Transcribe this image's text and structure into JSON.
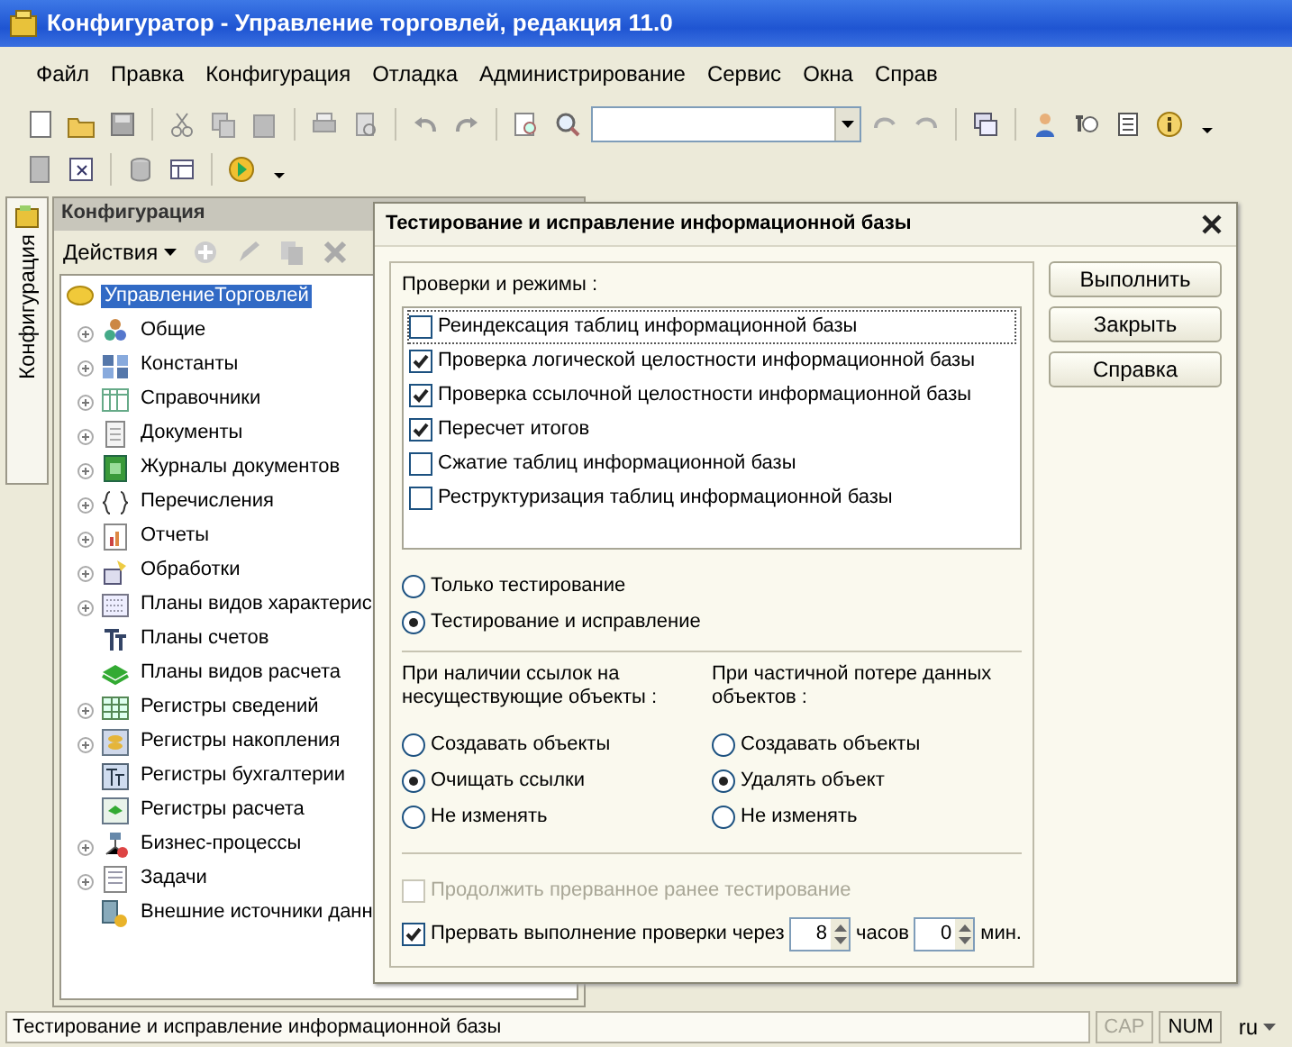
{
  "window": {
    "title": "Конфигуратор - Управление торговлей, редакция 11.0"
  },
  "menu": [
    "Файл",
    "Правка",
    "Конфигурация",
    "Отладка",
    "Администрирование",
    "Сервис",
    "Окна",
    "Справ"
  ],
  "side_tab": {
    "label": "Конфигурация",
    "selected": true
  },
  "config_panel": {
    "title": "Конфигурация",
    "actions": "Действия",
    "tree": {
      "label": "УправлениеТорговлей",
      "selected": true,
      "children": [
        {
          "label": "Общие",
          "expandable": true
        },
        {
          "label": "Константы",
          "expandable": true
        },
        {
          "label": "Справочники",
          "expandable": true
        },
        {
          "label": "Документы",
          "expandable": true
        },
        {
          "label": "Журналы документов",
          "expandable": true
        },
        {
          "label": "Перечисления",
          "expandable": true
        },
        {
          "label": "Отчеты",
          "expandable": true
        },
        {
          "label": "Обработки",
          "expandable": true
        },
        {
          "label": "Планы видов характерис",
          "expandable": true
        },
        {
          "label": "Планы счетов",
          "expandable": false
        },
        {
          "label": "Планы видов расчета",
          "expandable": false
        },
        {
          "label": "Регистры сведений",
          "expandable": true
        },
        {
          "label": "Регистры накопления",
          "expandable": true
        },
        {
          "label": "Регистры бухгалтерии",
          "expandable": false
        },
        {
          "label": "Регистры расчета",
          "expandable": false
        },
        {
          "label": "Бизнес-процессы",
          "expandable": true
        },
        {
          "label": "Задачи",
          "expandable": true
        },
        {
          "label": "Внешние источники данн",
          "expandable": false
        }
      ]
    }
  },
  "dialog": {
    "title": "Тестирование и исправление информационной базы",
    "checks_label": "Проверки и режимы :",
    "checks": [
      {
        "label": "Реиндексация таблиц информационной базы",
        "checked": false,
        "focused": true
      },
      {
        "label": "Проверка логической целостности информационной базы",
        "checked": true,
        "focused": false
      },
      {
        "label": "Проверка ссылочной целостности информационной базы",
        "checked": true,
        "focused": false
      },
      {
        "label": "Пересчет итогов",
        "checked": true,
        "focused": false
      },
      {
        "label": "Сжатие таблиц информационной базы",
        "checked": false,
        "focused": false
      },
      {
        "label": "Реструктуризация таблиц информационной базы",
        "checked": false,
        "focused": false
      }
    ],
    "modes": [
      {
        "label": "Только тестирование",
        "selected": false
      },
      {
        "label": "Тестирование и исправление",
        "selected": true
      }
    ],
    "groups": [
      {
        "label": "При наличии ссылок на несуществующие объекты :",
        "options": [
          {
            "label": "Создавать объекты",
            "selected": false
          },
          {
            "label": "Очищать ссылки",
            "selected": true
          },
          {
            "label": "Не изменять",
            "selected": false
          }
        ]
      },
      {
        "label": "При частичной потере данных объектов :",
        "options": [
          {
            "label": "Создавать объекты",
            "selected": false
          },
          {
            "label": "Удалять объект",
            "selected": true
          },
          {
            "label": "Не изменять",
            "selected": false
          }
        ]
      }
    ],
    "resume": {
      "label": "Продолжить прерванное ранее тестирование",
      "checked": false,
      "disabled": true
    },
    "interrupt": {
      "label": "Прервать выполнение проверки через",
      "checked": true,
      "hours": "8",
      "hours_unit": "часов",
      "minutes": "0",
      "minutes_unit": "мин."
    },
    "buttons": [
      "Выполнить",
      "Закрыть",
      "Справка"
    ]
  },
  "status_bar": {
    "text": "Тестирование и исправление информационной базы",
    "indicators": [
      {
        "label": "CAP",
        "on": false
      },
      {
        "label": "NUM",
        "on": true
      }
    ],
    "language": "ru"
  }
}
